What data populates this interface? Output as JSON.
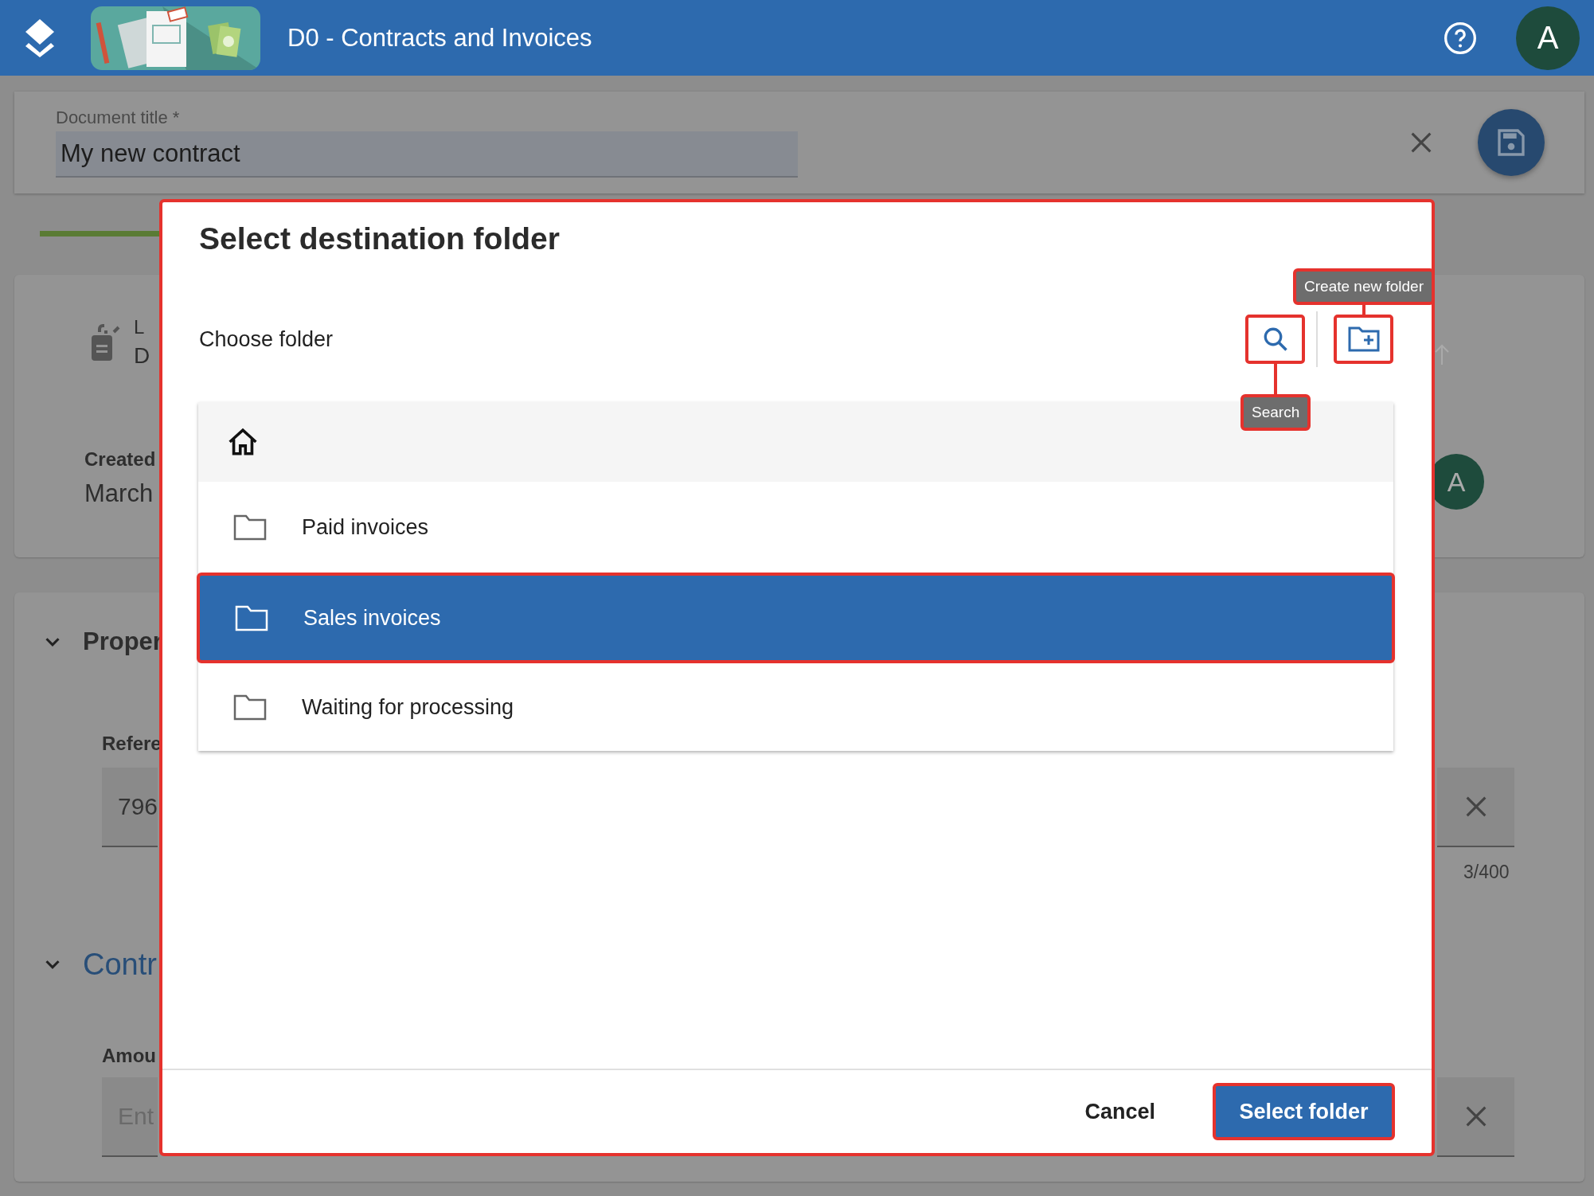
{
  "app_bar": {
    "title": "D0 - Contracts and Invoices",
    "avatar": "A"
  },
  "document": {
    "title_label": "Document title *",
    "title_value": "My new contract"
  },
  "summary_card": {
    "line_1": "L",
    "line_2": "D",
    "created_label": "Created",
    "created_value": "March",
    "avatar": "A"
  },
  "properties_section": {
    "heading": "Proper",
    "expanded": true,
    "field_label": "Refere",
    "field_value": "796",
    "counter": "3/400"
  },
  "contract_section": {
    "heading": "Contr",
    "expanded": true,
    "field_label": "Amou",
    "field_placeholder": "Ent"
  },
  "dialog": {
    "title": "Select destination folder",
    "subtitle": "Choose folder",
    "create_tooltip": "Create new folder",
    "search_tooltip": "Search",
    "folders": [
      {
        "name": "Paid invoices",
        "selected": false
      },
      {
        "name": "Sales invoices",
        "selected": true
      },
      {
        "name": "Waiting for processing",
        "selected": false
      }
    ],
    "cancel": "Cancel",
    "confirm": "Select folder"
  }
}
